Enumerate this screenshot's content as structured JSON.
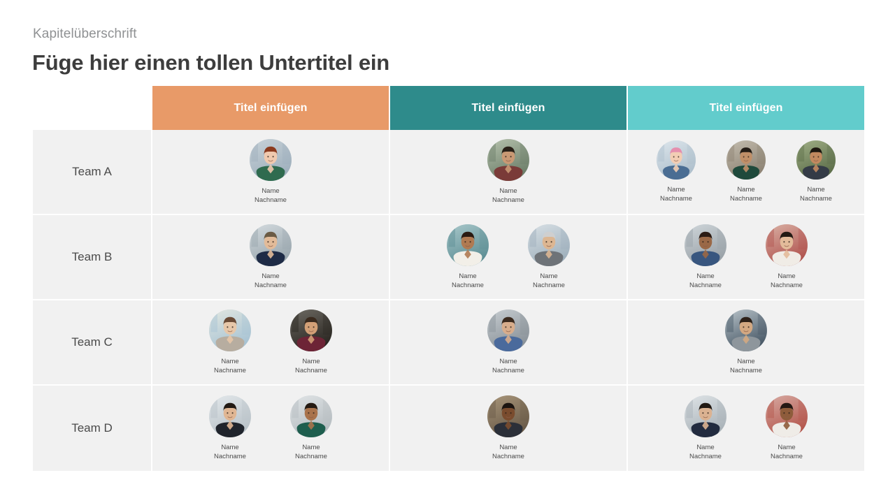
{
  "slide": {
    "eyebrow": "Kapitelüberschrift",
    "title": "Füge hier einen tollen Untertitel ein"
  },
  "colors": {
    "header_1": "#e89a68",
    "header_2": "#2e8b8b",
    "header_3": "#62cccc",
    "cell_background": "#f1f1f1",
    "divider": "#ffffff",
    "title_text": "#3d3d3d",
    "eyebrow_text": "#8f9193",
    "label_text": "#4a4a4a"
  },
  "table": {
    "columns": [
      {
        "label": "Titel einfügen",
        "color": "#e89a68"
      },
      {
        "label": "Titel einfügen",
        "color": "#2e8b8b"
      },
      {
        "label": "Titel einfügen",
        "color": "#62cccc"
      }
    ],
    "rows": [
      {
        "label": "Team A",
        "cells": [
          {
            "people": [
              {
                "first": "Name",
                "last": "Nachname",
                "avatar": "woman-red-hair-green-top"
              }
            ]
          },
          {
            "people": [
              {
                "first": "Name",
                "last": "Nachname",
                "avatar": "man-plaid-shirt-outdoors"
              }
            ]
          },
          {
            "people": [
              {
                "first": "Name",
                "last": "Nachname",
                "avatar": "woman-pink-hair-denim"
              },
              {
                "first": "Name",
                "last": "Nachname",
                "avatar": "man-glasses-backpack-street"
              },
              {
                "first": "Name",
                "last": "Nachname",
                "avatar": "man-suit-smiling-outdoors"
              }
            ]
          }
        ]
      },
      {
        "label": "Team B",
        "cells": [
          {
            "people": [
              {
                "first": "Name",
                "last": "Nachname",
                "avatar": "man-navy-suit-city"
              }
            ]
          },
          {
            "people": [
              {
                "first": "Name",
                "last": "Nachname",
                "avatar": "woman-curly-hair-white-blazer"
              },
              {
                "first": "Name",
                "last": "Nachname",
                "avatar": "senior-man-grey-suit-pointing"
              }
            ]
          },
          {
            "people": [
              {
                "first": "Name",
                "last": "Nachname",
                "avatar": "woman-afro-blue-blouse"
              },
              {
                "first": "Name",
                "last": "Nachname",
                "avatar": "woman-long-hair-white-top"
              }
            ]
          }
        ]
      },
      {
        "label": "Team C",
        "cells": [
          {
            "people": [
              {
                "first": "Name",
                "last": "Nachname",
                "avatar": "woman-beach-scarf"
              },
              {
                "first": "Name",
                "last": "Nachname",
                "avatar": "man-burgundy-suit-beard"
              }
            ]
          },
          {
            "people": [
              {
                "first": "Name",
                "last": "Nachname",
                "avatar": "woman-floral-blouse-indoor"
              }
            ]
          },
          {
            "people": [
              {
                "first": "Name",
                "last": "Nachname",
                "avatar": "woman-grey-blazer-hallway"
              }
            ]
          }
        ]
      },
      {
        "label": "Team D",
        "cells": [
          {
            "people": [
              {
                "first": "Name",
                "last": "Nachname",
                "avatar": "woman-black-blazer-white-top"
              },
              {
                "first": "Name",
                "last": "Nachname",
                "avatar": "man-green-shirt-smiling"
              }
            ]
          },
          {
            "people": [
              {
                "first": "Name",
                "last": "Nachname",
                "avatar": "man-dark-shirt-library"
              }
            ]
          },
          {
            "people": [
              {
                "first": "Name",
                "last": "Nachname",
                "avatar": "woman-navy-blazer-street"
              },
              {
                "first": "Name",
                "last": "Nachname",
                "avatar": "man-curly-hair-white-tee"
              }
            ]
          }
        ]
      }
    ]
  }
}
